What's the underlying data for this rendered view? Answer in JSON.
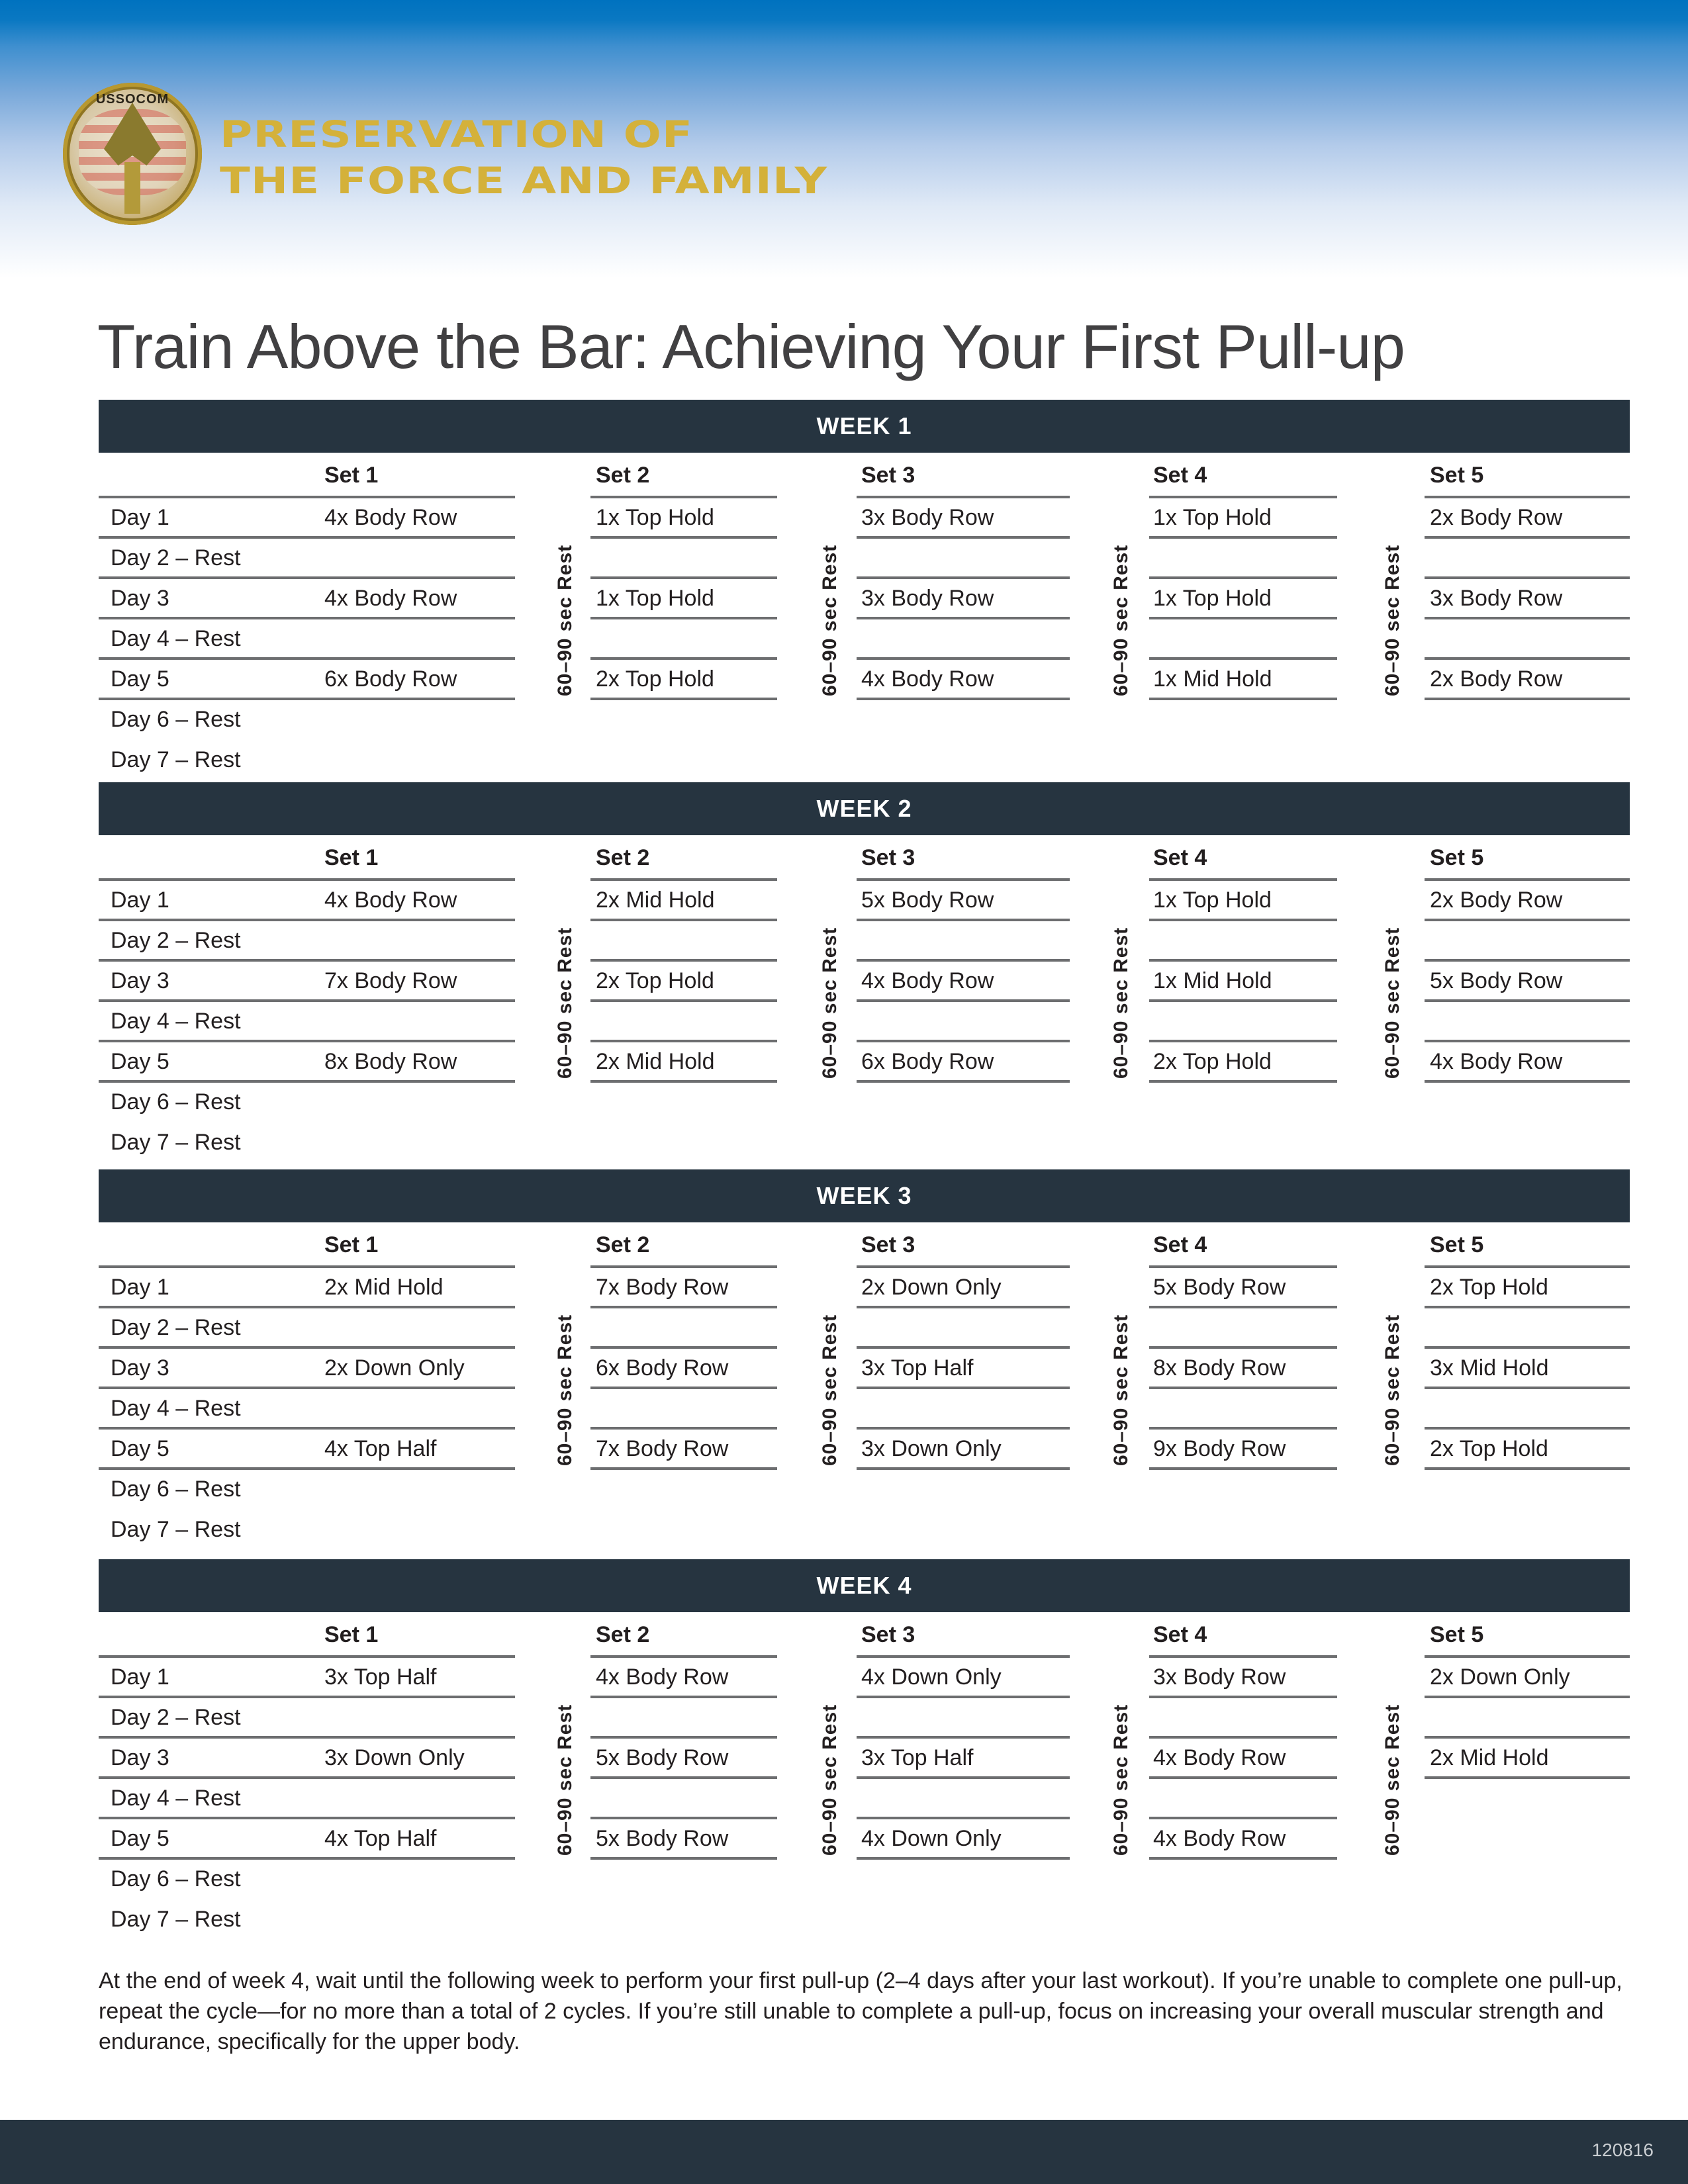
{
  "header": {
    "logo": {
      "icon": "ussocom-seal-icon",
      "ring_text": "USSOCOM",
      "bottom_text": "Preservation of the Force & Family"
    },
    "brand_line1": "PRESERVATION OF",
    "brand_line2": "THE FORCE AND FAMILY"
  },
  "title": "Train Above the Bar: Achieving Your First Pull-up",
  "rest_label": "60–90 sec Rest",
  "set_headers": [
    "Set 1",
    "Set 2",
    "Set 3",
    "Set 4",
    "Set 5"
  ],
  "day_labels": [
    "Day 1",
    "Day 2 – Rest",
    "Day 3",
    "Day 4 – Rest",
    "Day 5",
    "Day 6 – Rest",
    "Day 7 – Rest"
  ],
  "weeks": [
    {
      "label": "WEEK 1",
      "day1": [
        "4x Body Row",
        "1x Top Hold",
        "3x Body Row",
        "1x Top Hold",
        "2x Body Row"
      ],
      "day3": [
        "4x Body Row",
        "1x Top Hold",
        "3x Body Row",
        "1x Top Hold",
        "3x Body Row"
      ],
      "day5": [
        "6x Body Row",
        "2x Top Hold",
        "4x Body Row",
        "1x Mid Hold",
        "2x Body Row"
      ]
    },
    {
      "label": "WEEK 2",
      "day1": [
        "4x Body Row",
        "2x Mid Hold",
        "5x Body Row",
        "1x Top Hold",
        "2x Body Row"
      ],
      "day3": [
        "7x Body Row",
        "2x Top Hold",
        "4x Body Row",
        "1x Mid Hold",
        "5x Body Row"
      ],
      "day5": [
        "8x Body Row",
        "2x Mid Hold",
        "6x Body Row",
        "2x Top Hold",
        "4x Body Row"
      ]
    },
    {
      "label": "WEEK 3",
      "day1": [
        "2x Mid Hold",
        "7x Body Row",
        "2x Down Only",
        "5x Body Row",
        "2x Top Hold"
      ],
      "day3": [
        "2x Down Only",
        "6x Body Row",
        "3x Top Half",
        "8x Body Row",
        "3x Mid Hold"
      ],
      "day5": [
        "4x Top Half",
        "7x Body Row",
        "3x Down Only",
        "9x Body Row",
        "2x Top Hold"
      ]
    },
    {
      "label": "WEEK 4",
      "day1": [
        "3x Top Half",
        "4x Body Row",
        "4x Down Only",
        "3x Body Row",
        "2x Down Only"
      ],
      "day3": [
        "3x Down Only",
        "5x Body Row",
        "3x Top Half",
        "4x Body Row",
        "2x Mid Hold"
      ],
      "day5": [
        "4x Top Half",
        "5x Body Row",
        "4x Down Only",
        "4x Body Row",
        ""
      ]
    }
  ],
  "footnote": "At the end of week 4, wait until the following week to perform your first pull-up (2–4 days after your last workout). If you’re unable to complete one pull-up, repeat the cycle—for no more than a total of 2 cycles. If you’re still unable to complete a pull-up, focus on increasing your overall muscular strength and endurance, specifically for the upper body.",
  "footer": {
    "code": "120816"
  }
}
